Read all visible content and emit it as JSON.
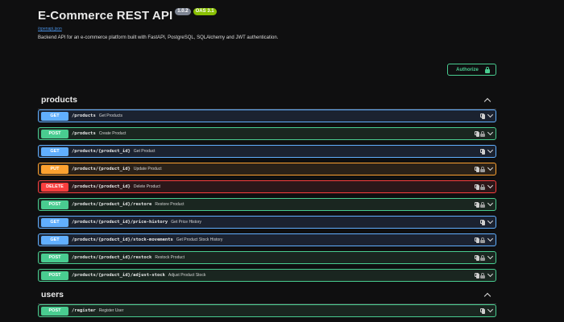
{
  "header": {
    "title": "E-Commerce REST API",
    "version": "1.0.2",
    "oas": "OAS 3.1",
    "spec_link": "/openapi.json",
    "description": "Backend API for an e-commerce platform built with FastAPI, PostgreSQL, SQLAlchemy and JWT authentication."
  },
  "authorize": {
    "label": "Authorize"
  },
  "sections": {
    "products": {
      "title": "products"
    },
    "users": {
      "title": "users"
    }
  },
  "operations": [
    {
      "method": "GET",
      "path": "/products",
      "summary": "Get Products"
    },
    {
      "method": "POST",
      "path": "/products",
      "summary": "Create Product"
    },
    {
      "method": "GET",
      "path": "/products/{product_id}",
      "summary": "Get Product"
    },
    {
      "method": "PUT",
      "path": "/products/{product_id}",
      "summary": "Update Product"
    },
    {
      "method": "DELETE",
      "path": "/products/{product_id}",
      "summary": "Delete Product"
    },
    {
      "method": "POST",
      "path": "/products/{product_id}/restore",
      "summary": "Restore Product"
    },
    {
      "method": "GET",
      "path": "/products/{product_id}/price-history",
      "summary": "Get Price History"
    },
    {
      "method": "GET",
      "path": "/products/{product_id}/stock-movements",
      "summary": "Get Product Stock History"
    },
    {
      "method": "POST",
      "path": "/products/{product_id}/restock",
      "summary": "Restock Product"
    },
    {
      "method": "POST",
      "path": "/products/{product_id}/adjust-stock",
      "summary": "Adjust Product Stock"
    },
    {
      "method": "POST",
      "path": "/register",
      "summary": "Register User"
    }
  ],
  "colors": {
    "get": "#61affe",
    "post": "#49cc90",
    "put": "#fca130",
    "delete": "#f93e3e",
    "background": "#0f0f10"
  }
}
